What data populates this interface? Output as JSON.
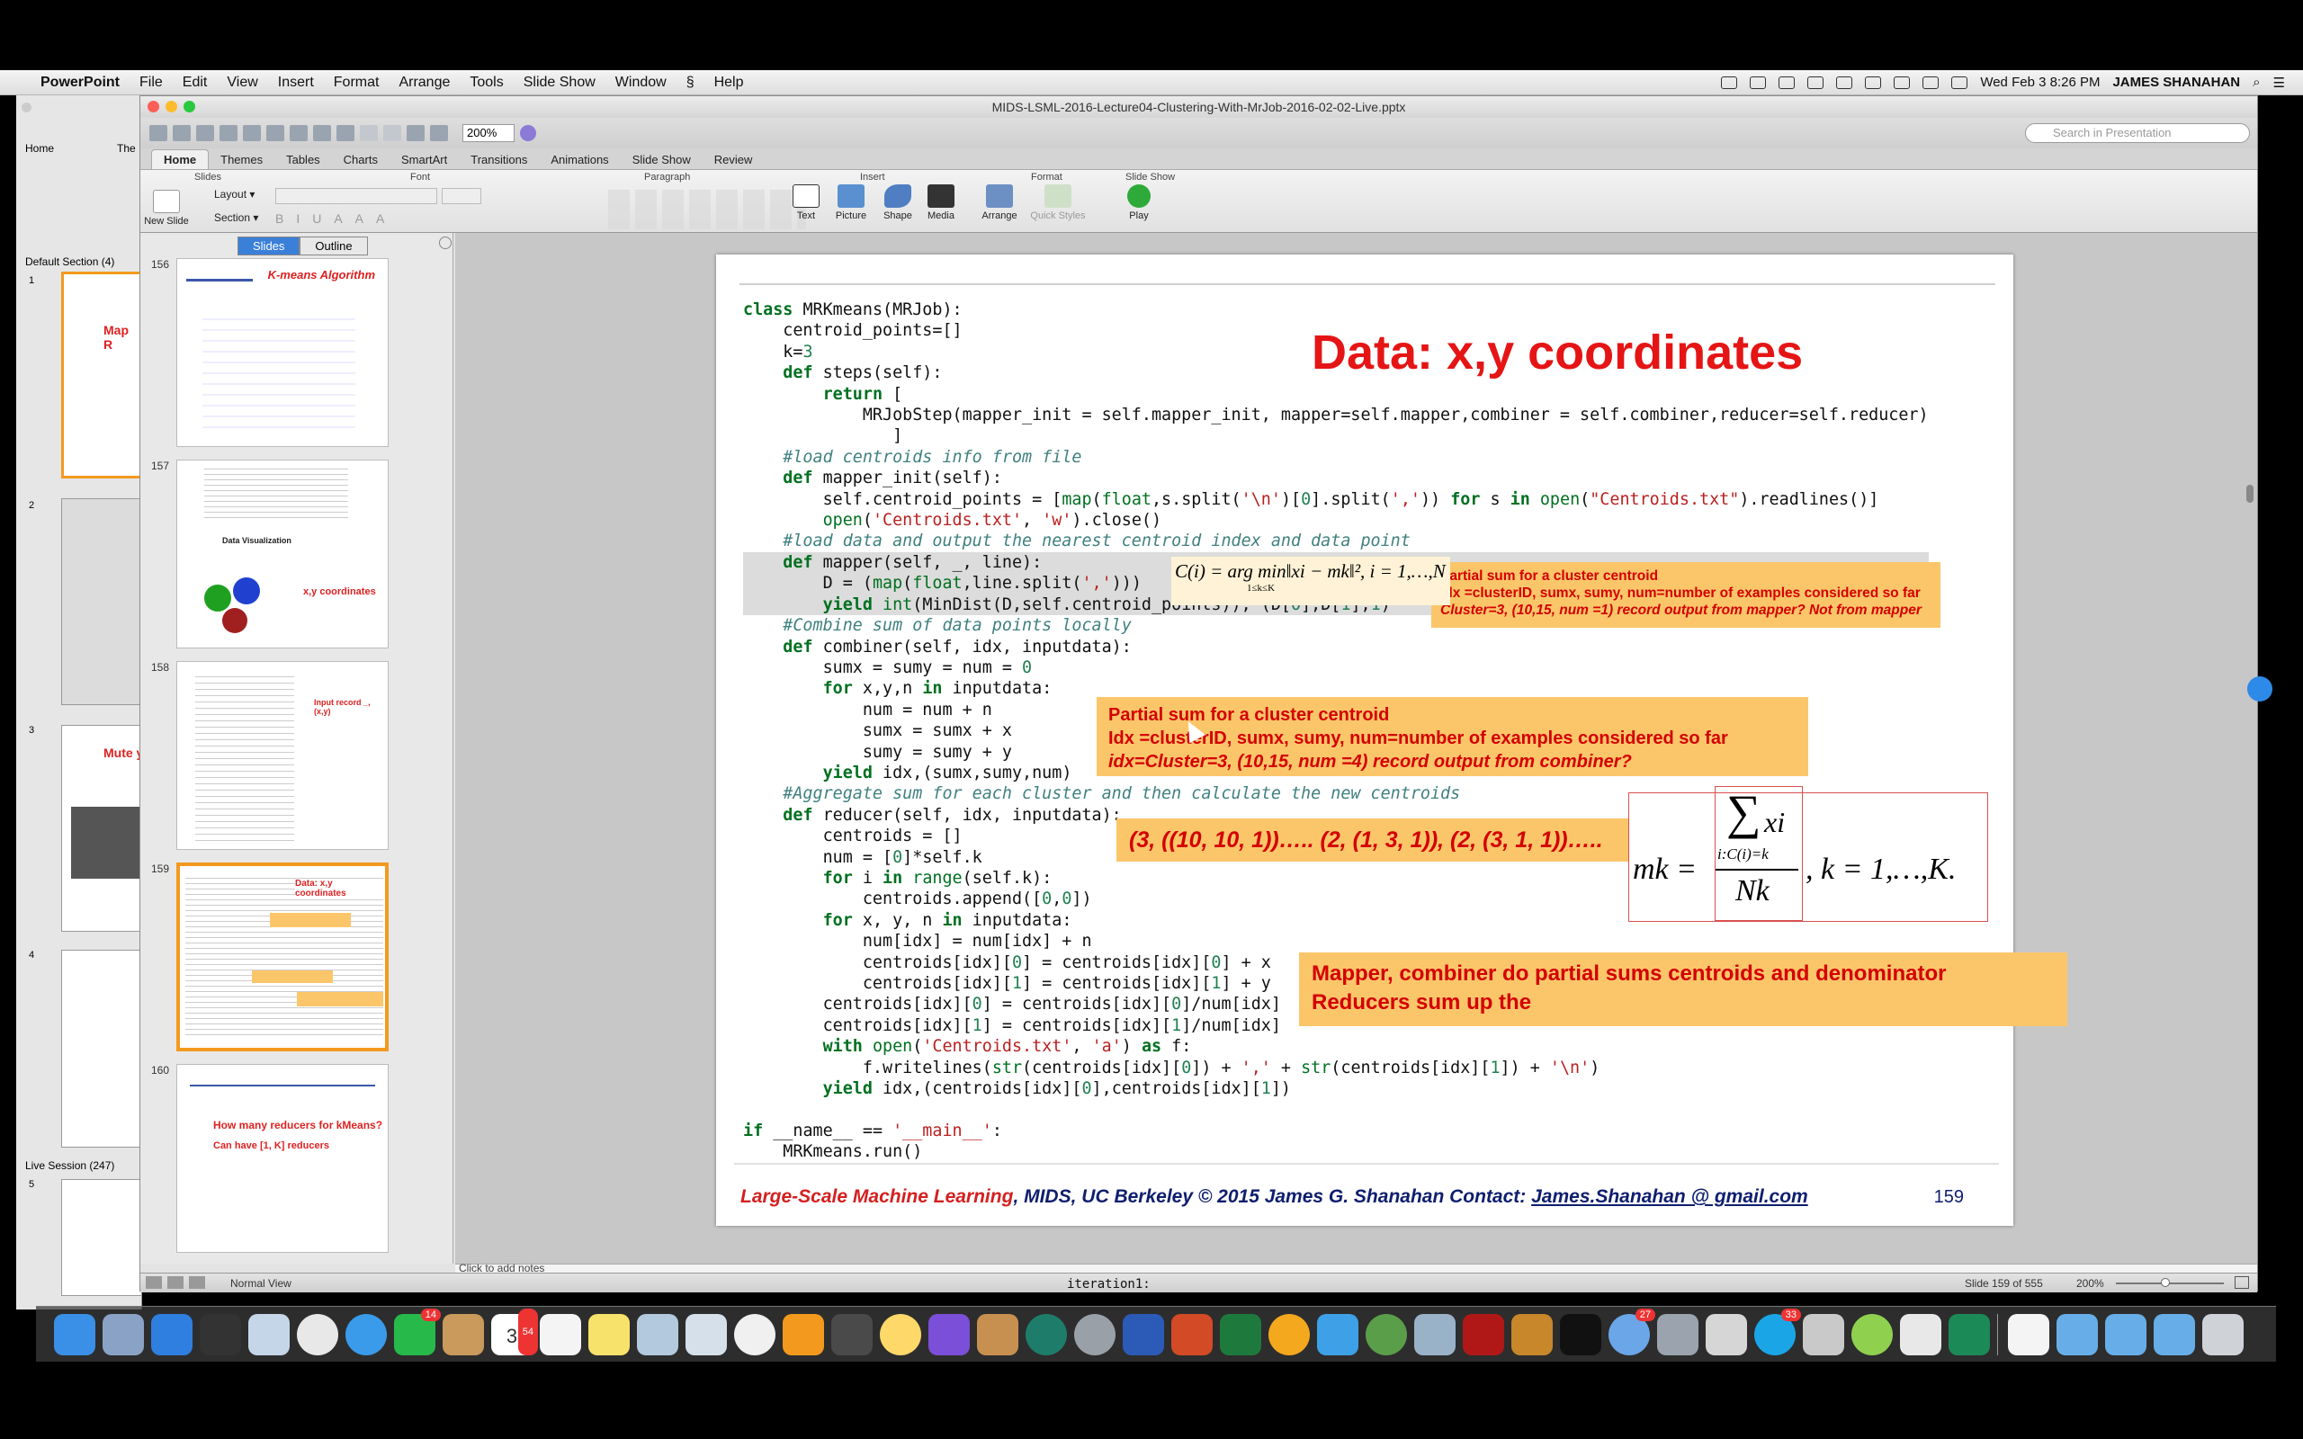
{
  "menubar": {
    "app": "PowerPoint",
    "items": [
      "File",
      "Edit",
      "View",
      "Insert",
      "Format",
      "Arrange",
      "Tools",
      "Slide Show",
      "Window",
      "Help"
    ],
    "clock": "Wed Feb 3  8:26 PM",
    "user": "JAMES SHANAHAN"
  },
  "window": {
    "title": "MIDS-LSML-2016-Lecture04-Clustering-With-MrJob-2016-02-02-Live.pptx",
    "zoom": "200%",
    "search_placeholder": "Search in Presentation"
  },
  "ribbon": {
    "tabs": [
      "Home",
      "Themes",
      "Tables",
      "Charts",
      "SmartArt",
      "Transitions",
      "Animations",
      "Slide Show",
      "Review"
    ],
    "groups": [
      "Slides",
      "Font",
      "Paragraph",
      "Insert",
      "Format",
      "Slide Show"
    ],
    "buttons": {
      "new_slide": "New Slide",
      "layout": "Layout",
      "section": "Section",
      "text": "Text",
      "picture": "Picture",
      "shape": "Shape",
      "media": "Media",
      "arrange": "Arrange",
      "quick_styles": "Quick Styles",
      "play": "Play"
    }
  },
  "bg_window": {
    "tab_home": "Home",
    "tab_themes": "The",
    "section_default": "Default Section (4)",
    "section_live": "Live Session (247)",
    "thumb_nums": [
      "1",
      "2",
      "3",
      "4",
      "5"
    ],
    "thumb1_title": "Map R",
    "thumb3_title": "Mute yo"
  },
  "slide_pane": {
    "tabs": [
      "Slides",
      "Outline"
    ],
    "thumbnails": [
      {
        "num": "156",
        "title": "K-means Algorithm"
      },
      {
        "num": "157",
        "title": "x,y coordinates",
        "subtitle": "Data Visualization"
      },
      {
        "num": "158",
        "title": "Input record _, (x,y)"
      },
      {
        "num": "159",
        "title": "Data: x,y coordinates"
      },
      {
        "num": "160",
        "title": "How many reducers for kMeans?",
        "subtitle": "Can have [1, K] reducers"
      }
    ]
  },
  "slide": {
    "title": "Data: x,y coordinates",
    "code_lines": [
      "class MRKmeans(MRJob):",
      "    centroid_points=[]",
      "    k=3",
      "    def steps(self):",
      "        return [",
      "            MRJobStep(mapper_init = self.mapper_init, mapper=self.mapper,combiner = self.combiner,reducer=self.reducer)",
      "               ]",
      "    #load centroids info from file",
      "    def mapper_init(self):",
      "        self.centroid_points = [map(float,s.split('\\n')[0].split(',')) for s in open(\"Centroids.txt\").readlines()]",
      "        open('Centroids.txt', 'w').close()",
      "    #load data and output the nearest centroid index and data point",
      "    def mapper(self, _, line):",
      "        D = (map(float,line.split(',')))",
      "        yield int(MinDist(D,self.centroid_points)), (D[0],D[1],1)",
      "    #Combine sum of data points locally",
      "    def combiner(self, idx, inputdata):",
      "        sumx = sumy = num = 0",
      "        for x,y,n in inputdata:",
      "            num = num + n",
      "            sumx = sumx + x",
      "            sumy = sumy + y",
      "        yield idx,(sumx,sumy,num)",
      "    #Aggregate sum for each cluster and then calculate the new centroids",
      "    def reducer(self, idx, inputdata):",
      "        centroids = []",
      "        num = [0]*self.k",
      "        for i in range(self.k):",
      "            centroids.append([0,0])",
      "        for x, y, n in inputdata:",
      "            num[idx] = num[idx] + n",
      "            centroids[idx][0] = centroids[idx][0] + x",
      "            centroids[idx][1] = centroids[idx][1] + y",
      "        centroids[idx][0] = centroids[idx][0]/num[idx]",
      "        centroids[idx][1] = centroids[idx][1]/num[idx]",
      "        with open('Centroids.txt', 'a') as f:",
      "            f.writelines(str(centroids[idx][0]) + ',' + str(centroids[idx][1]) + '\\n')",
      "        yield idx,(centroids[idx][0],centroids[idx][1])",
      "",
      "if __name__ == '__main__':",
      "    MRKmeans.run()"
    ],
    "callout_mapper": {
      "line1": "Partial sum for a cluster centroid",
      "line2": "Idx =clusterID, sumx, sumy, num=number of examples considered so far",
      "line3": "Cluster=3, (10,15, num =1)  record output from mapper? Not from mapper"
    },
    "callout_combiner": {
      "line1": "Partial sum for a cluster centroid",
      "line2": "Idx =clusterID, sumx, sumy, num=number of examples considered so far",
      "line3": "idx=Cluster=3, (10,15, num =4)   record output from combiner?"
    },
    "callout_tuples": "(3, ((10, 10, 1))….. (2, (1, 3, 1)), (2, (3, 1, 1))…..",
    "callout_summary": {
      "line1": "Mapper, combiner do partial sums centroids and denominator",
      "line2": "Reducers sum up the"
    },
    "argmin_formula": "C(i) = arg min‖xi − mk‖², i = 1,…,N",
    "argmin_sub": "1≤k≤K",
    "centroid_formula": {
      "lhs": "mk =",
      "sum": "∑",
      "numer_var": "xi",
      "sum_index": "i:C(i)=k",
      "denominator": "Nk",
      "rhs": ", k = 1,…,K."
    },
    "footer": {
      "course": "Large-Scale Machine Learning",
      "rest": ", MIDS, UC Berkeley ©  2015 James G. Shanahan   Contact: ",
      "email": "James.Shanahan @ gmail.com"
    },
    "page_number": "159"
  },
  "notes_placeholder": "Click to add notes",
  "status": {
    "view": "Normal View",
    "slide_count": "Slide 159 of 555",
    "zoom": "200%",
    "behind_text": "iteration1:"
  },
  "dock": {
    "badges": {
      "facetime": "14",
      "calendar": "54",
      "messages": "27",
      "skype": "33"
    },
    "calendar_day": "3"
  },
  "colors": {
    "slide_title": "#e51515",
    "callout_bg": "#fbc66a",
    "callout_text": "#d40000",
    "footer_text": "#0e1e6e",
    "selected_thumb": "#f39a1e"
  }
}
